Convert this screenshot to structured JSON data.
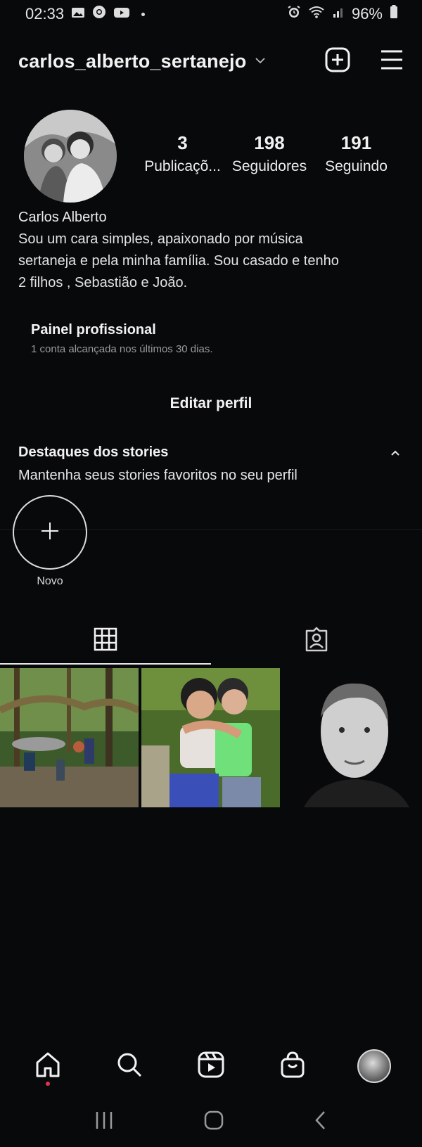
{
  "status_bar": {
    "time": "02:33",
    "battery": "96%",
    "left_icons": [
      "gallery-icon",
      "chrome-icon",
      "youtube-icon"
    ],
    "right_icons": [
      "alarm-icon",
      "wifi-icon",
      "signal-icon",
      "battery-icon"
    ]
  },
  "header": {
    "username": "carlos_alberto_sertanejo",
    "actions": [
      "new-post-icon",
      "menu-icon"
    ]
  },
  "profile": {
    "stats": [
      {
        "value": "3",
        "label": "Publicaçõ..."
      },
      {
        "value": "198",
        "label": "Seguidores"
      },
      {
        "value": "191",
        "label": "Seguindo"
      }
    ],
    "name": "Carlos Alberto",
    "bio_lines": [
      "Sou um cara simples, apaixonado por música",
      "sertaneja e pela minha família.  Sou casado e tenho",
      "2 filhos , Sebastião e João."
    ]
  },
  "professional_panel": {
    "title": "Painel profissional",
    "subtitle": "1 conta alcançada nos últimos 30 dias."
  },
  "edit_profile_label": "Editar perfil",
  "highlights": {
    "title": "Destaques dos stories",
    "subtitle": "Mantenha seus stories favoritos no seu perfil",
    "new_label": "Novo"
  },
  "tabs": [
    "grid-icon",
    "tagged-icon"
  ],
  "posts": [
    "forest-group-photo",
    "two-children-hugging-photo",
    "portrait-photo"
  ],
  "bottom_nav": [
    "home-icon",
    "search-icon",
    "reels-icon",
    "shop-icon",
    "profile-avatar"
  ],
  "colors": {
    "background": "#08090b",
    "text": "#f2f2f2",
    "notification": "#e2344a"
  }
}
